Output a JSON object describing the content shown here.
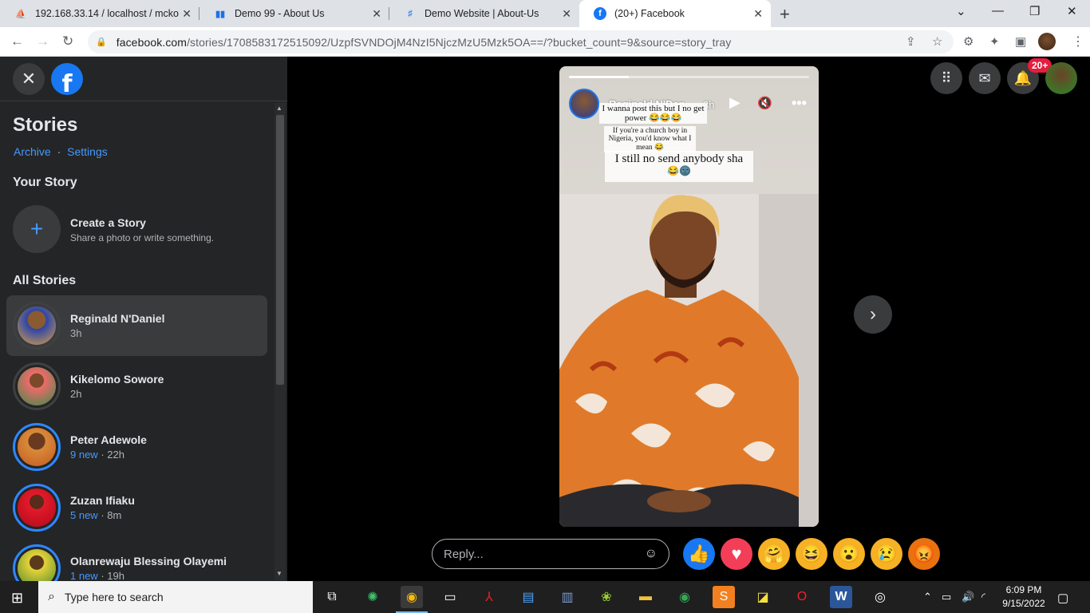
{
  "browser": {
    "tabs": [
      {
        "label": "192.168.33.14 / localhost / mckor",
        "icon": "phpmyadmin-icon",
        "active": false
      },
      {
        "label": "Demo 99 - About Us",
        "icon": "analytics-icon",
        "active": false
      },
      {
        "label": "Demo Website | About-Us",
        "icon": "wordpress-icon",
        "active": false
      },
      {
        "label": "(20+) Facebook",
        "icon": "facebook-icon",
        "active": true
      }
    ],
    "url_domain": "facebook.com",
    "url_path": "/stories/1708583172515092/UzpfSVNDOjM4NzI5NjczMzU5Mzk5OA==/?bucket_count=9&source=story_tray"
  },
  "sidebar": {
    "title": "Stories",
    "archive_link": "Archive",
    "separator": "·",
    "settings_link": "Settings",
    "your_story_heading": "Your Story",
    "create_title": "Create a Story",
    "create_subtitle": "Share a photo or write something.",
    "all_stories_heading": "All Stories",
    "stories": [
      {
        "name": "Reginald N'Daniel",
        "new": "",
        "time": "3h",
        "selected": true
      },
      {
        "name": "Kikelomo Sowore",
        "new": "",
        "time": "2h",
        "selected": false
      },
      {
        "name": "Peter Adewole",
        "new": "9 new",
        "time": "22h",
        "selected": false
      },
      {
        "name": "Zuzan Ifiaku",
        "new": "5 new",
        "time": "8m",
        "selected": false
      },
      {
        "name": "Olanrewaju Blessing Olayemi",
        "new": "1 new",
        "time": "19h",
        "selected": false
      }
    ]
  },
  "viewer": {
    "author": "Reginald N'Dan...",
    "time": "3h",
    "progress": 0.25,
    "caption1": "I wanna post this but I no get power 😂😂😂",
    "caption2": "If you're a church boy in Nigeria, you'd know what I mean 😂",
    "caption3": "I still no send anybody sha",
    "caption3_emoji": "😂🌚",
    "reply_placeholder": "Reply...",
    "notifications_badge": "20+",
    "reactions": [
      "like",
      "love",
      "care",
      "haha",
      "wow",
      "sad",
      "angry"
    ]
  },
  "taskbar": {
    "search_placeholder": "Type here to search",
    "time": "6:09 PM",
    "date": "9/15/2022"
  },
  "colors": {
    "accent": "#1877f2",
    "link": "#4599ff",
    "sidebar_bg": "#242526",
    "badge": "#e41e3f"
  }
}
